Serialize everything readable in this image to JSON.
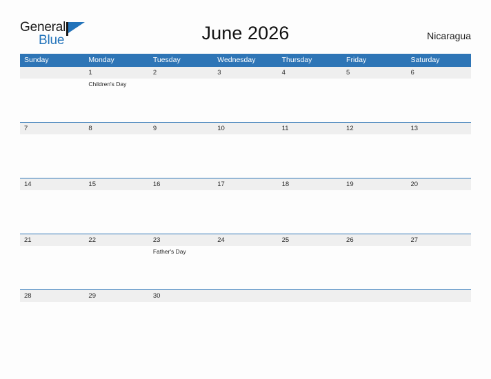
{
  "brand": {
    "word_one": "General",
    "word_two": "Blue",
    "flag_icon": "blue-flag-triangle-icon",
    "accent_color": "#2273ba"
  },
  "header": {
    "title": "June 2026",
    "country": "Nicaragua"
  },
  "calendar": {
    "header_bg": "#2e75b6",
    "date_row_bg": "#efefef",
    "rule_color": "#2e75b6",
    "weekdays": [
      "Sunday",
      "Monday",
      "Tuesday",
      "Wednesday",
      "Thursday",
      "Friday",
      "Saturday"
    ],
    "weeks": [
      {
        "dates": [
          "",
          "1",
          "2",
          "3",
          "4",
          "5",
          "6"
        ],
        "events": [
          "",
          "Children's Day",
          "",
          "",
          "",
          "",
          ""
        ]
      },
      {
        "dates": [
          "7",
          "8",
          "9",
          "10",
          "11",
          "12",
          "13"
        ],
        "events": [
          "",
          "",
          "",
          "",
          "",
          "",
          ""
        ]
      },
      {
        "dates": [
          "14",
          "15",
          "16",
          "17",
          "18",
          "19",
          "20"
        ],
        "events": [
          "",
          "",
          "",
          "",
          "",
          "",
          ""
        ]
      },
      {
        "dates": [
          "21",
          "22",
          "23",
          "24",
          "25",
          "26",
          "27"
        ],
        "events": [
          "",
          "",
          "Father's Day",
          "",
          "",
          "",
          ""
        ]
      },
      {
        "dates": [
          "28",
          "29",
          "30",
          "",
          "",
          "",
          ""
        ],
        "events": [
          "",
          "",
          "",
          "",
          "",
          "",
          ""
        ]
      }
    ]
  }
}
